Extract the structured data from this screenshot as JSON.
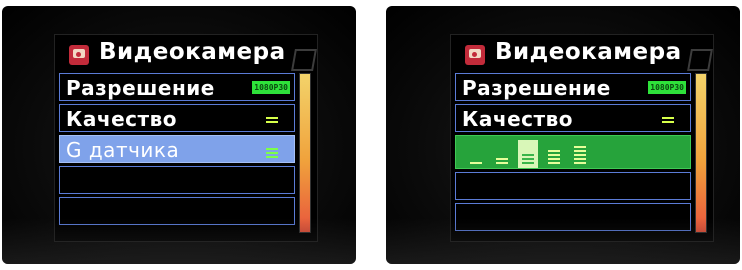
{
  "screens": [
    {
      "title": "Видеокамера",
      "menu": [
        {
          "label": "Разрешение",
          "value": "1080P30"
        },
        {
          "label": "Качество",
          "value_icon": "quality-level-icon"
        },
        {
          "label": "G датчика",
          "value_icon": "g-sensor-level-icon",
          "selected": true
        },
        {
          "label": ""
        },
        {
          "label": ""
        }
      ]
    },
    {
      "title": "Видеокамера",
      "menu": [
        {
          "label": "Разрешение",
          "value": "1080P30"
        },
        {
          "label": "Качество",
          "value_icon": "quality-level-icon"
        }
      ],
      "g_sensor_options": {
        "levels": [
          1,
          2,
          3,
          4,
          5
        ],
        "selected_level": 3
      }
    }
  ],
  "colors": {
    "menu_border": "#5b7bd6",
    "selected_blue": "#7fa2ea",
    "selected_green": "#26a33b",
    "badge_green": "#2ee23a"
  }
}
